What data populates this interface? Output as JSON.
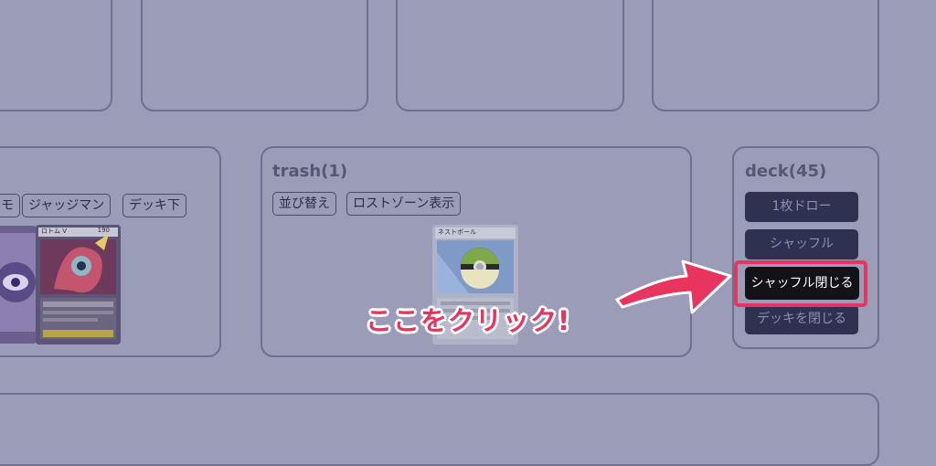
{
  "left_zone": {
    "buttons": [
      "モ",
      "ジャッジマン",
      "デッキ下"
    ],
    "card_label": "ロトム V",
    "card_hp": "190"
  },
  "trash_zone": {
    "title": "trash(1)",
    "buttons": [
      "並び替え",
      "ロストゾーン表示"
    ],
    "card_label": "ネストボール"
  },
  "deck_zone": {
    "title": "deck(45)",
    "buttons": {
      "draw": "1枚ドロー",
      "shuffle": "シャッフル",
      "close_shuffle": "シャッフル閉じる",
      "close_deck": "デッキを閉じる"
    }
  },
  "annotation": {
    "text": "ここをクリック!",
    "color": "#e8355f"
  },
  "colors": {
    "overlay_bg": "#9a9cb8",
    "button_dark": "#2e3150",
    "highlight": "#e8355f"
  }
}
